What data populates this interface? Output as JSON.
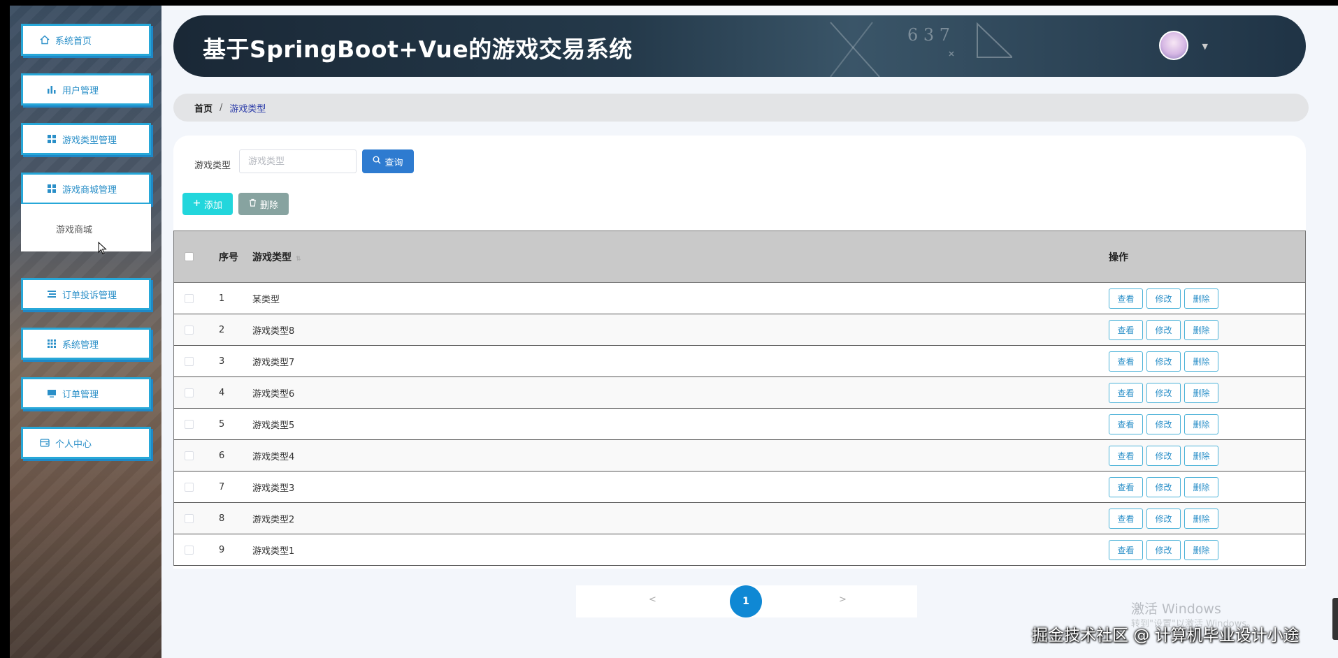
{
  "app": {
    "title": "基于SpringBoot+Vue的游戏交易系统"
  },
  "sidebar": {
    "items": [
      {
        "label": "系统首页",
        "icon": "home-icon"
      },
      {
        "label": "用户管理",
        "icon": "bar-chart-icon"
      },
      {
        "label": "游戏类型管理",
        "icon": "grid-icon"
      },
      {
        "label": "游戏商城管理",
        "icon": "grid-icon"
      },
      {
        "label": "订单投诉管理",
        "icon": "list-icon"
      },
      {
        "label": "系统管理",
        "icon": "apps-icon"
      },
      {
        "label": "订单管理",
        "icon": "monitor-icon"
      },
      {
        "label": "个人中心",
        "icon": "wallet-icon"
      }
    ],
    "submenu": {
      "label": "游戏商城"
    }
  },
  "breadcrumb": {
    "home": "首页",
    "separator": "/",
    "current": "游戏类型"
  },
  "search": {
    "label": "游戏类型",
    "placeholder": "游戏类型",
    "button": "查询"
  },
  "actions": {
    "add": "添加",
    "delete": "删除"
  },
  "table": {
    "columns": {
      "index": "序号",
      "type": "游戏类型",
      "operations": "操作"
    },
    "row_actions": {
      "view": "查看",
      "edit": "修改",
      "delete": "删除"
    },
    "rows": [
      {
        "index": "1",
        "type": "某类型"
      },
      {
        "index": "2",
        "type": "游戏类型8"
      },
      {
        "index": "3",
        "type": "游戏类型7"
      },
      {
        "index": "4",
        "type": "游戏类型6"
      },
      {
        "index": "5",
        "type": "游戏类型5"
      },
      {
        "index": "6",
        "type": "游戏类型4"
      },
      {
        "index": "7",
        "type": "游戏类型3"
      },
      {
        "index": "8",
        "type": "游戏类型2"
      },
      {
        "index": "9",
        "type": "游戏类型1"
      }
    ]
  },
  "pagination": {
    "prev": "<",
    "current": "1",
    "next": ">"
  },
  "overlay": {
    "activate_title": "激活 Windows",
    "activate_sub": "转到\"设置\"以激活 Windows。",
    "credit": "掘金技术社区 @ 计算机毕业设计小途"
  },
  "header_deco": "6 3 7",
  "colors": {
    "accent": "#27a7d8",
    "primary_button": "#2e7bd0",
    "add_button": "#22d6dc",
    "delete_button": "#87a3a0",
    "pager_active": "#0f88d4"
  }
}
